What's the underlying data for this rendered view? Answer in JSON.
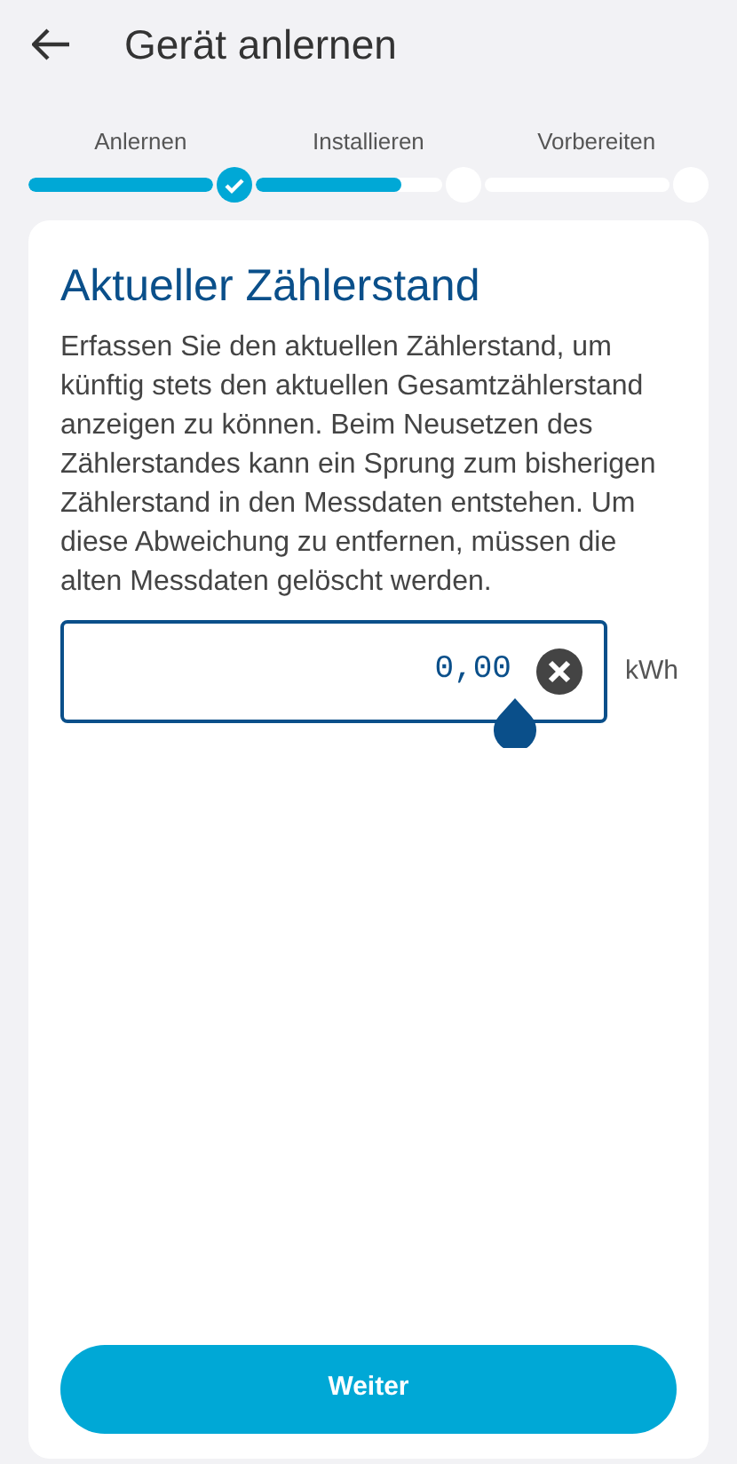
{
  "header": {
    "title": "Gerät anlernen"
  },
  "steps": [
    {
      "label": "Anlernen",
      "level": 1,
      "done": true
    },
    {
      "label": "Installieren",
      "level": 0.78,
      "done": false
    },
    {
      "label": "Vorbereiten",
      "level": 0,
      "done": false
    }
  ],
  "card": {
    "heading": "Aktueller Zählerstand",
    "description": "Erfassen Sie den aktuellen Zählerstand, um künftig stets den aktuellen Gesamtzählerstand anzeigen zu können. Beim Neusetzen des Zählerstandes kann ein Sprung zum bisherigen Zählerstand in den Messdaten entstehen. Um diese Abweichung zu entfernen, müssen die alten Messdaten gelöscht werden.",
    "field": {
      "value": "0,00",
      "unit": "kWh"
    },
    "button": "Weiter"
  }
}
